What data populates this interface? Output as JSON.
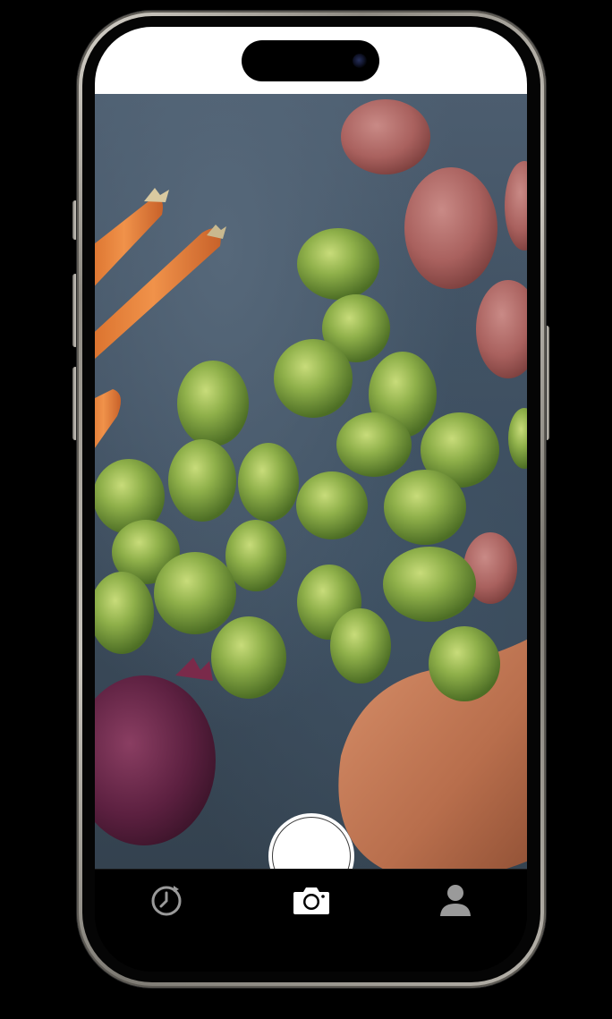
{
  "app": {
    "screen": "camera-capture"
  },
  "viewfinder": {
    "subject": "vegetables"
  },
  "shutter": {
    "icon": "shutter-button"
  },
  "tab_bar": {
    "tabs": [
      {
        "id": "history",
        "icon": "history-clock-icon",
        "active": false
      },
      {
        "id": "camera",
        "icon": "camera-icon",
        "active": true
      },
      {
        "id": "profile",
        "icon": "person-icon",
        "active": false
      }
    ]
  },
  "colors": {
    "frame": "#c9c5bd",
    "screen_bg": "#000000",
    "status_bg": "#ffffff",
    "tab_icon_inactive": "#9a9a9a",
    "tab_icon_active": "#ffffff",
    "shutter": "#ffffff"
  }
}
